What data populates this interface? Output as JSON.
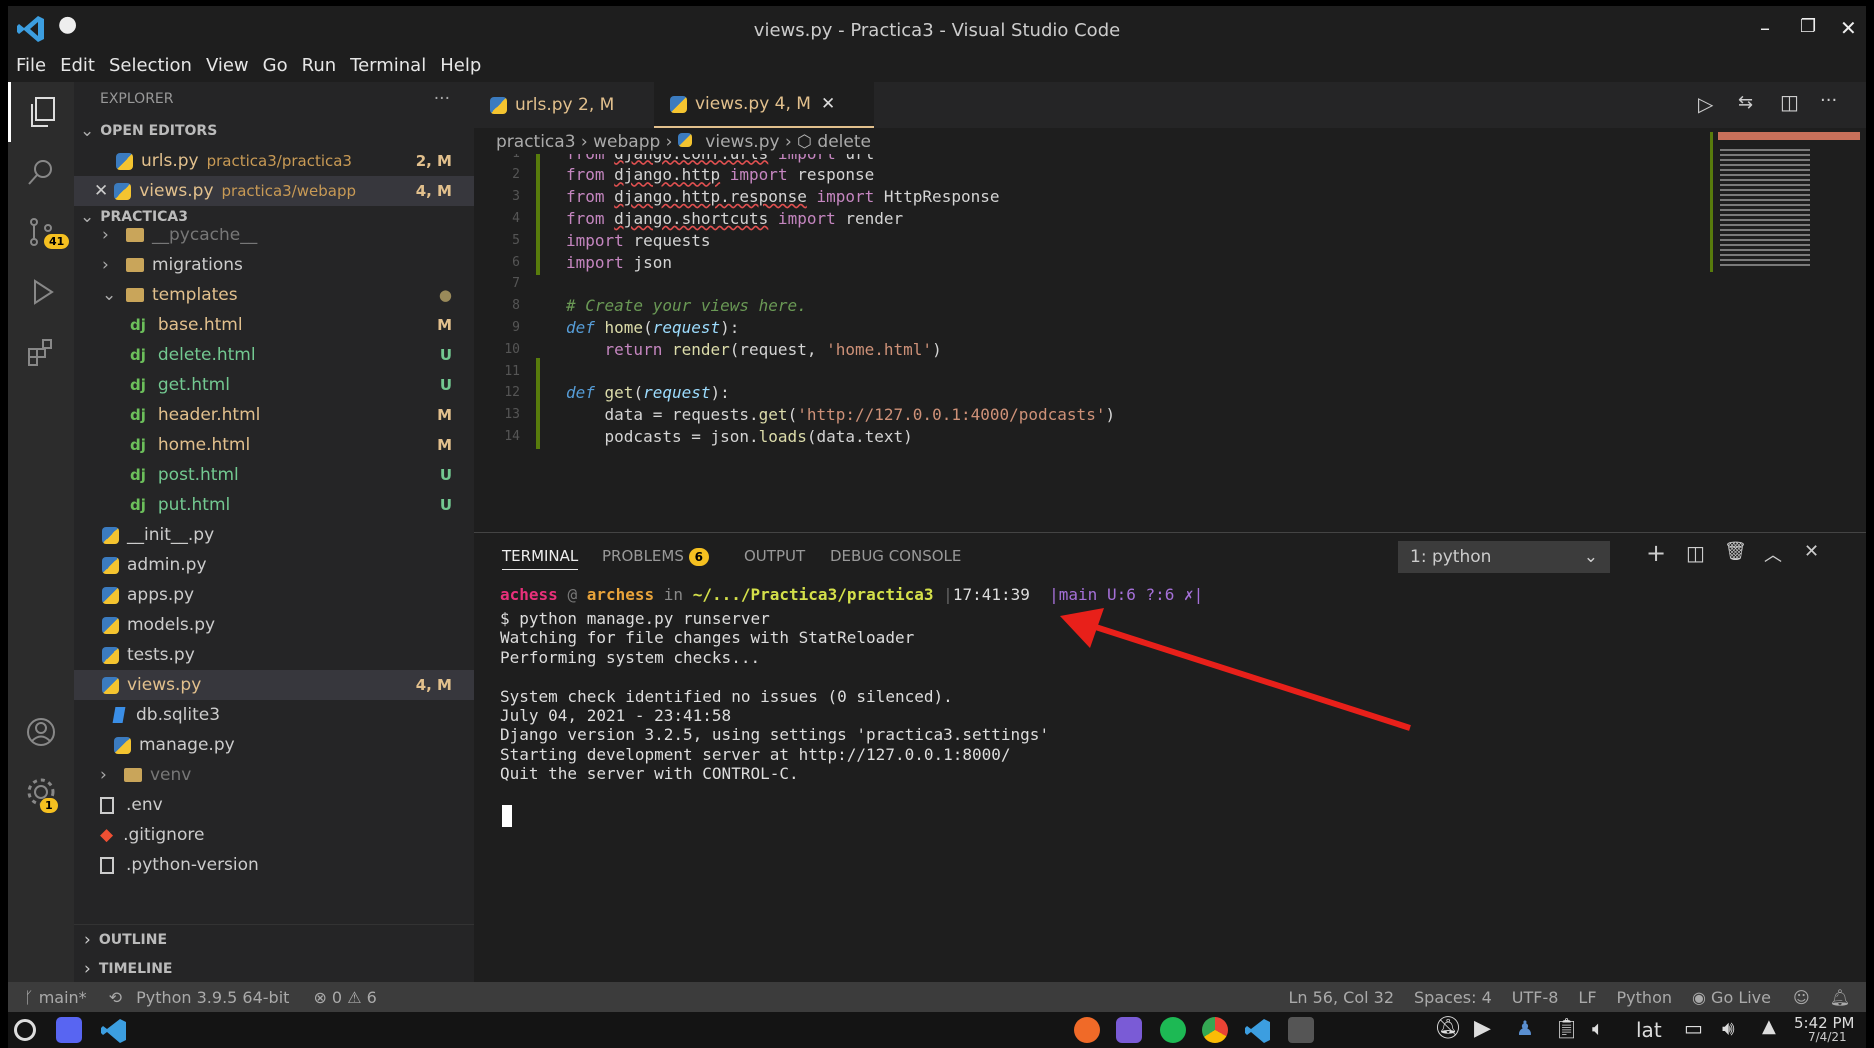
{
  "window": {
    "title": "views.py - Practica3 - Visual Studio Code",
    "min": "–",
    "restore": "❐",
    "close": "✕"
  },
  "menu": [
    "File",
    "Edit",
    "Selection",
    "View",
    "Go",
    "Run",
    "Terminal",
    "Help"
  ],
  "activity": {
    "scm_badge": "41",
    "settings_badge": "1"
  },
  "sidebar": {
    "header": "EXPLORER",
    "more": "···",
    "open_editors": "OPEN EDITORS",
    "project": "PRACTICA3",
    "open": [
      {
        "name": "urls.py",
        "path": "practica3/practica3",
        "status": "2, M"
      },
      {
        "name": "views.py",
        "path": "practica3/webapp",
        "status": "4, M"
      }
    ],
    "tree": [
      {
        "name": "__pycache__",
        "kind": "folder",
        "indent": 1,
        "status": ""
      },
      {
        "name": "migrations",
        "kind": "folder",
        "indent": 1,
        "status": ""
      },
      {
        "name": "templates",
        "kind": "folder-open",
        "indent": 1,
        "status": "●"
      },
      {
        "name": "base.html",
        "kind": "dj",
        "indent": 2,
        "status": "M"
      },
      {
        "name": "delete.html",
        "kind": "dj",
        "indent": 2,
        "status": "U"
      },
      {
        "name": "get.html",
        "kind": "dj",
        "indent": 2,
        "status": "U"
      },
      {
        "name": "header.html",
        "kind": "dj",
        "indent": 2,
        "status": "M"
      },
      {
        "name": "home.html",
        "kind": "dj",
        "indent": 2,
        "status": "M"
      },
      {
        "name": "post.html",
        "kind": "dj",
        "indent": 2,
        "status": "U"
      },
      {
        "name": "put.html",
        "kind": "dj",
        "indent": 2,
        "status": "U"
      },
      {
        "name": "__init__.py",
        "kind": "py",
        "indent": 1,
        "status": ""
      },
      {
        "name": "admin.py",
        "kind": "py",
        "indent": 1,
        "status": ""
      },
      {
        "name": "apps.py",
        "kind": "py",
        "indent": 1,
        "status": ""
      },
      {
        "name": "models.py",
        "kind": "py",
        "indent": 1,
        "status": ""
      },
      {
        "name": "tests.py",
        "kind": "py",
        "indent": 1,
        "status": ""
      },
      {
        "name": "views.py",
        "kind": "py",
        "indent": 1,
        "status": "4, M"
      },
      {
        "name": "db.sqlite3",
        "kind": "db",
        "indent": 0,
        "status": ""
      },
      {
        "name": "manage.py",
        "kind": "py",
        "indent": 0,
        "status": ""
      },
      {
        "name": "venv",
        "kind": "folder",
        "indent": -1,
        "status": ""
      },
      {
        "name": ".env",
        "kind": "file",
        "indent": -1,
        "status": ""
      },
      {
        "name": ".gitignore",
        "kind": "git",
        "indent": -1,
        "status": ""
      },
      {
        "name": ".python-version",
        "kind": "file",
        "indent": -1,
        "status": ""
      }
    ],
    "outline": "OUTLINE",
    "timeline": "TIMELINE"
  },
  "editor": {
    "tabs": [
      {
        "label": "urls.py 2, M"
      },
      {
        "label": "views.py 4, M"
      }
    ],
    "breadcrumb": [
      "practica3",
      "webapp",
      "views.py",
      "delete"
    ],
    "lines": [
      {
        "n": "1",
        "g": true,
        "t": [
          [
            "kw",
            "from "
          ],
          [
            "mod-n",
            "django.conf.urls"
          ],
          [
            "kw",
            " import "
          ],
          [
            "var",
            "url"
          ]
        ]
      },
      {
        "n": "2",
        "g": true,
        "t": [
          [
            "kw",
            "from "
          ],
          [
            "mod-n",
            "django.http"
          ],
          [
            "kw",
            " import "
          ],
          [
            "var",
            "response"
          ]
        ]
      },
      {
        "n": "3",
        "g": true,
        "t": [
          [
            "kw",
            "from "
          ],
          [
            "mod-n",
            "django.http.response"
          ],
          [
            "kw",
            " import "
          ],
          [
            "var",
            "HttpResponse"
          ]
        ]
      },
      {
        "n": "4",
        "g": true,
        "t": [
          [
            "kw",
            "from "
          ],
          [
            "mod-n",
            "django.shortcuts"
          ],
          [
            "kw",
            " import "
          ],
          [
            "var",
            "render"
          ]
        ]
      },
      {
        "n": "5",
        "g": true,
        "t": [
          [
            "kw",
            "import "
          ],
          [
            "var",
            "requests"
          ]
        ]
      },
      {
        "n": "6",
        "g": true,
        "t": [
          [
            "kw",
            "import "
          ],
          [
            "var",
            "json"
          ]
        ]
      },
      {
        "n": "7",
        "g": false,
        "t": []
      },
      {
        "n": "8",
        "g": false,
        "t": [
          [
            "com",
            "# Create your views here."
          ]
        ]
      },
      {
        "n": "9",
        "g": false,
        "t": [
          [
            "kw2",
            "def "
          ],
          [
            "fn",
            "home"
          ],
          [
            "var",
            "("
          ],
          [
            "prm",
            "request"
          ],
          [
            "var",
            "):"
          ]
        ]
      },
      {
        "n": "10",
        "g": false,
        "t": [
          [
            "var",
            "    "
          ],
          [
            "kw",
            "return "
          ],
          [
            "fn",
            "render"
          ],
          [
            "var",
            "(request, "
          ],
          [
            "str",
            "'home.html'"
          ],
          [
            "var",
            ")"
          ]
        ]
      },
      {
        "n": "11",
        "g": true,
        "t": []
      },
      {
        "n": "12",
        "g": true,
        "t": [
          [
            "kw2",
            "def "
          ],
          [
            "fn",
            "get"
          ],
          [
            "var",
            "("
          ],
          [
            "prm",
            "request"
          ],
          [
            "var",
            "):"
          ]
        ]
      },
      {
        "n": "13",
        "g": true,
        "t": [
          [
            "var",
            "    data = requests."
          ],
          [
            "fn",
            "get"
          ],
          [
            "var",
            "("
          ],
          [
            "str",
            "'http://127.0.0.1:4000/podcasts'"
          ],
          [
            "var",
            ")"
          ]
        ]
      },
      {
        "n": "14",
        "g": true,
        "t": [
          [
            "var",
            "    podcasts = json."
          ],
          [
            "fn",
            "loads"
          ],
          [
            "var",
            "(data.text)"
          ]
        ]
      }
    ]
  },
  "panel": {
    "tabs": [
      "TERMINAL",
      "PROBLEMS",
      "OUTPUT",
      "DEBUG CONSOLE"
    ],
    "problems_count": "6",
    "terminal_select": "1: python",
    "prompt": {
      "user": "achess",
      "at": "@",
      "host": "archess",
      "in": "in",
      "path": "~/.../Practica3/practica3",
      "time": "17:41:39",
      "git": "|main U:6 ?:6 ✗|"
    },
    "lines": [
      "$ python manage.py runserver",
      "Watching for file changes with StatReloader",
      "Performing system checks...",
      "",
      "System check identified no issues (0 silenced).",
      "July 04, 2021 - 23:41:58",
      "Django version 3.2.5, using settings 'practica3.settings'",
      "Starting development server at http://127.0.0.1:8000/",
      "Quit the server with CONTROL-C."
    ]
  },
  "status": {
    "branch": "main*",
    "python": "Python 3.9.5 64-bit",
    "problems": "⊗ 0 ⚠ 6",
    "position": "Ln 56, Col 32",
    "spaces": "Spaces: 4",
    "encoding": "UTF-8",
    "eol": "LF",
    "language": "Python",
    "golive": "Go Live"
  },
  "taskbar": {
    "lang": "lat",
    "time": "5:42 PM",
    "date": "7/4/21"
  },
  "colors": {
    "accent": "#0078d4",
    "modified": "#e2c08d",
    "untracked": "#73c991",
    "arrow": "#e8201a"
  }
}
